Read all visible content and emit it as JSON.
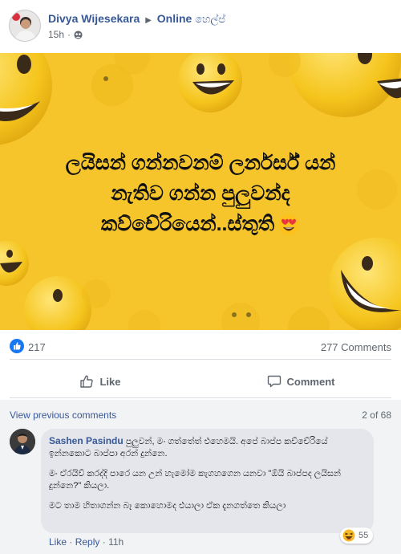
{
  "post": {
    "author": "Divya Wijesekara",
    "group": "Online",
    "group_suffix": "හෙල්ප්",
    "time": "15h",
    "image_text": [
      "ලයිසන් ගන්නවනම් ලර්නර්ස් යන්",
      "නැතිව ගන්න පුලුවන්ද",
      "කව්චේරියෙන්..ස්තුති"
    ],
    "reaction_count": "217",
    "comment_count": "277 Comments",
    "like_label": "Like",
    "comment_label": "Comment"
  },
  "comments": {
    "view_previous": "View previous comments",
    "pager": "2 of 68",
    "items": [
      {
        "author": "Sashen Pasindu",
        "paragraphs": [
          "පුලුවන්, මං ගත්තේත් එහෙමයි. අපේ බාප්ප කව්චේරියේ ඉන්නකොට බාප්පා අරන් දුන්නෙ.",
          "මං ඒරයිව් කරද්දි පාරෙ යන උන් හැමෝම කැගහගෙන යනවා \"ඕයි බාප්පද ලයිසන් දුන්නෙ?\" කියලා.",
          "මට තාම හිතාගන්න බෑ කොහොමද එයාලා ඒක දැනගත්තෙ කියලා"
        ],
        "reaction_count": "55",
        "like_label": "Like",
        "reply_label": "Reply",
        "separator": "·",
        "time": "11h"
      }
    ]
  },
  "colors": {
    "link": "#385898",
    "like_blue": "#1877f2",
    "image_bg": "#f6c52b"
  }
}
